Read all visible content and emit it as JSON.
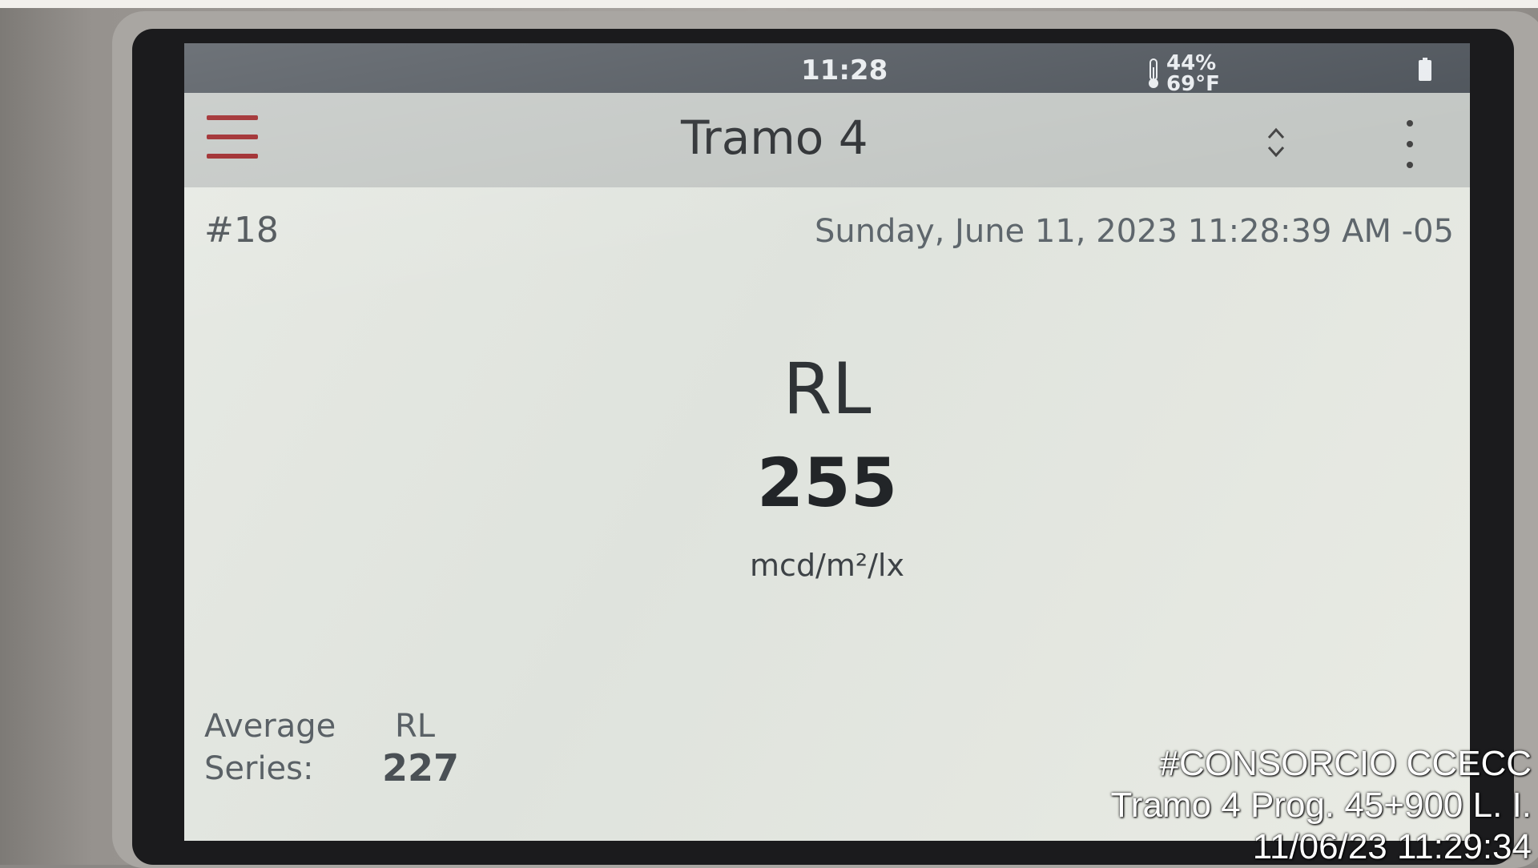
{
  "status_bar": {
    "time": "11:28",
    "humidity": "44%",
    "temperature": "69°F"
  },
  "title_bar": {
    "title": "Tramo 4"
  },
  "measurement": {
    "record_number": "#18",
    "timestamp": "Sunday, June 11, 2023 11:28:39 AM -05",
    "label": "RL",
    "value": "255",
    "unit": "mcd/m²/lx"
  },
  "average": {
    "label_line1": "Average",
    "label_line2": "Series:",
    "metric": "RL",
    "value": "227"
  },
  "watermark": {
    "line1": "#CONSORCIO CCECC",
    "line2": "Tramo 4 Prog. 45+900 L. I.",
    "line3": "11/06/23  11:29:34"
  },
  "colors": {
    "menu_accent": "#9a1f22",
    "status_bar": "#4e545b",
    "title_bar": "#c3c7c4",
    "screen_bg": "#dfe2dc"
  },
  "icons": [
    "hamburger-menu-icon",
    "thermometer-icon",
    "battery-icon",
    "sort-icon",
    "more-vertical-icon"
  ]
}
